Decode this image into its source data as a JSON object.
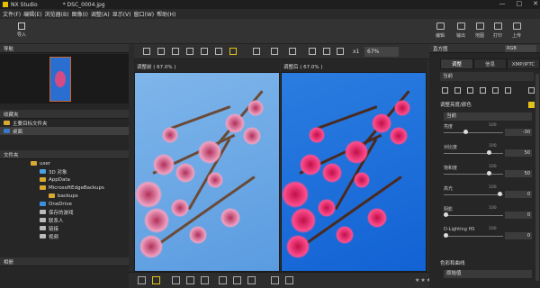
{
  "app": {
    "name": "NX Studio",
    "file": "* DSC_0004.jpg",
    "controls": [
      "—",
      "□",
      "✕"
    ]
  },
  "menu": [
    "文件(F)",
    "编辑(E)",
    "浏览器(B)",
    "图像(I)",
    "调整(A)",
    "显示(V)",
    "窗口(W)",
    "帮助(H)"
  ],
  "toolbar": {
    "import": "导入",
    "right": [
      "编辑",
      "输出",
      "地图",
      "打印",
      "上传"
    ]
  },
  "left": {
    "nav_title": "导航",
    "fav_title": "收藏夹",
    "fav_items": [
      "主要目标文件夹",
      "桌面"
    ],
    "folder_title": "文件夹",
    "folder_items": [
      "user",
      "3D 对象",
      "AppData",
      "MicrosoftEdgeBackups",
      "backups",
      "OneDrive",
      "保存的游戏",
      "联系人",
      "链接",
      "视频"
    ],
    "hist_title": "相册"
  },
  "center": {
    "scale": "x1",
    "zoom": "67%",
    "paneA": "调整前 ( 67.0% )",
    "paneB": "调整后 ( 67.0% )"
  },
  "right": {
    "hist_title": "直方图",
    "hist_mode": "RGB",
    "tabs": [
      "调整",
      "信息",
      "XMP/IPTC"
    ],
    "curve_sel": "当前",
    "section": "调整亮度/颜色",
    "preset": "当前",
    "sliders": [
      {
        "label": "亮度",
        "max": "100",
        "value": "-30"
      },
      {
        "label": "对比度",
        "max": "100",
        "value": "50"
      },
      {
        "label": "饱和度",
        "max": "100",
        "value": "50"
      },
      {
        "label": "高光",
        "max": "100",
        "value": "0"
      },
      {
        "label": "阴影",
        "max": "100",
        "value": "0"
      },
      {
        "label": "D-Lighting HS",
        "max": "100",
        "value": "0"
      }
    ],
    "color_section": "色彩和曲线",
    "color_sel": "原始值"
  },
  "bottom": {
    "stars": "★★★★★"
  }
}
